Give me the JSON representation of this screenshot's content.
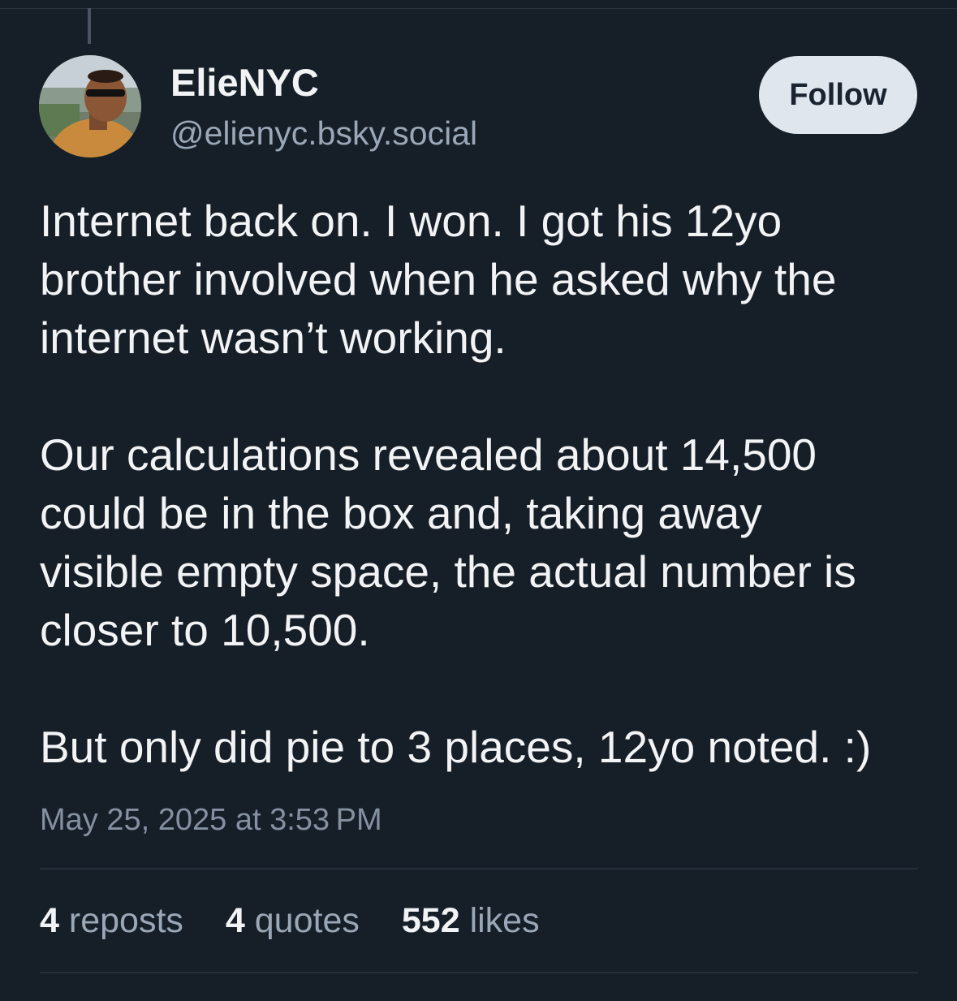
{
  "post": {
    "author": {
      "display_name": "ElieNYC",
      "handle": "@elienyc.bsky.social",
      "avatar": "avatar-photo"
    },
    "follow_label": "Follow",
    "body": [
      [
        "Internet back on. I won. I got his 12yo",
        "brother involved when he asked why the",
        "internet wasn’t working."
      ],
      [
        "Our calculations revealed about 14,500",
        "could be in the box and, taking away",
        "visible empty space, the actual number is",
        "closer to 10,500."
      ],
      [
        "But only did pie to 3 places, 12yo noted. :)"
      ]
    ],
    "timestamp": "May 25, 2025 at 3:53 PM",
    "stats": {
      "reposts": {
        "count": "4",
        "label": "reposts"
      },
      "quotes": {
        "count": "4",
        "label": "quotes"
      },
      "likes": {
        "count": "552",
        "label": "likes"
      }
    }
  },
  "colors": {
    "background": "#161e27",
    "text": "#f1f3f5",
    "muted": "#9aa7b6",
    "follow_bg": "#dfe6ee"
  }
}
